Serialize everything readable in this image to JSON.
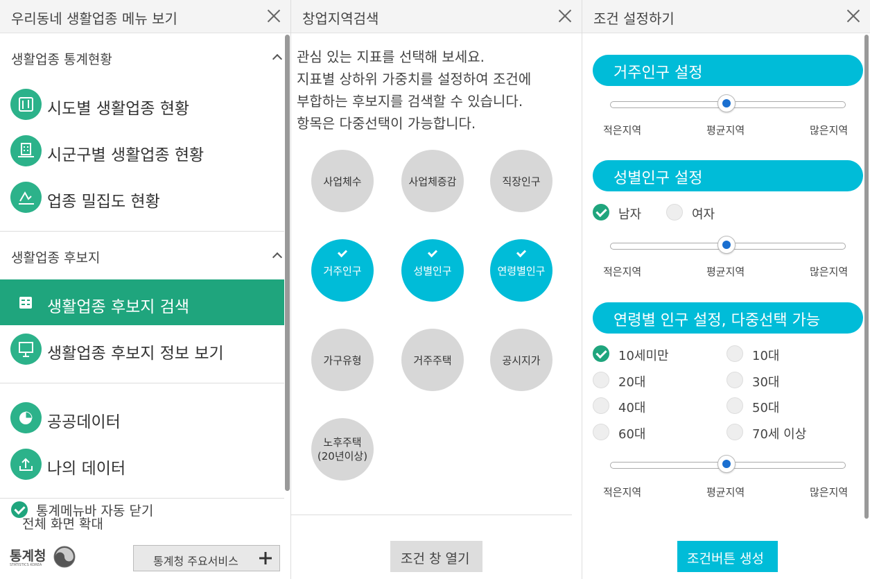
{
  "panel1": {
    "title": "우리동네 생활업종 메뉴 보기",
    "section1": "생활업종 통계현황",
    "items1": [
      "시도별 생활업종 현황",
      "시군구별 생활업종 현황",
      "업종 밀집도 현황"
    ],
    "section2": "생활업종 후보지",
    "items2": [
      "생활업종 후보지 검색",
      "생활업종 후보지 정보 보기"
    ],
    "items3": [
      "공공데이터",
      "나의 데이터"
    ],
    "auto_close": "통계메뉴바 자동 닫기",
    "fullscreen": "전체 화면 확대",
    "logo_text": "통계청",
    "logo_sub": "STATISTICS KOREA",
    "service_button": "통계청 주요서비스",
    "accent": "#1fa57d"
  },
  "panel2": {
    "title": "창업지역검색",
    "intro": [
      "관심 있는 지표를 선택해 보세요.",
      "지표별 상하위 가중치를 설정하여 조건에",
      "부합하는 후보지를 검색할 수 있습니다.",
      "항목은 다중선택이 가능합니다."
    ],
    "circles": [
      {
        "label": "사업체수",
        "selected": false
      },
      {
        "label": "사업체증감",
        "selected": false
      },
      {
        "label": "직장인구",
        "selected": false
      },
      {
        "label": "거주인구",
        "selected": true
      },
      {
        "label": "성별인구",
        "selected": true
      },
      {
        "label": "연령별인구",
        "selected": true
      },
      {
        "label": "가구유형",
        "selected": false
      },
      {
        "label": "거주주택",
        "selected": false
      },
      {
        "label": "공시지가",
        "selected": false
      }
    ],
    "circle_last": {
      "line1": "노후주택",
      "line2": "(20년이상)",
      "selected": false
    },
    "open_button": "조건 창 열기",
    "accent": "#00bcd8"
  },
  "panel3": {
    "title": "조건 설정하기",
    "section_resident": "거주인구 설정",
    "section_gender": "성별인구 설정",
    "section_age": "연령별 인구 설정, 다중선택 가능",
    "ticks": [
      "적은지역",
      "평균지역",
      "많은지역"
    ],
    "slider_value": 0.5,
    "gender_male": "남자",
    "gender_female": "여자",
    "gender_male_checked": true,
    "gender_female_checked": false,
    "ages": [
      {
        "label": "10세미만",
        "checked": true
      },
      {
        "label": "10대",
        "checked": false
      },
      {
        "label": "20대",
        "checked": false
      },
      {
        "label": "30대",
        "checked": false
      },
      {
        "label": "40대",
        "checked": false
      },
      {
        "label": "50대",
        "checked": false
      },
      {
        "label": "60대",
        "checked": false
      },
      {
        "label": "70세 이상",
        "checked": false
      }
    ],
    "create_button": "조건버튼 생성"
  }
}
